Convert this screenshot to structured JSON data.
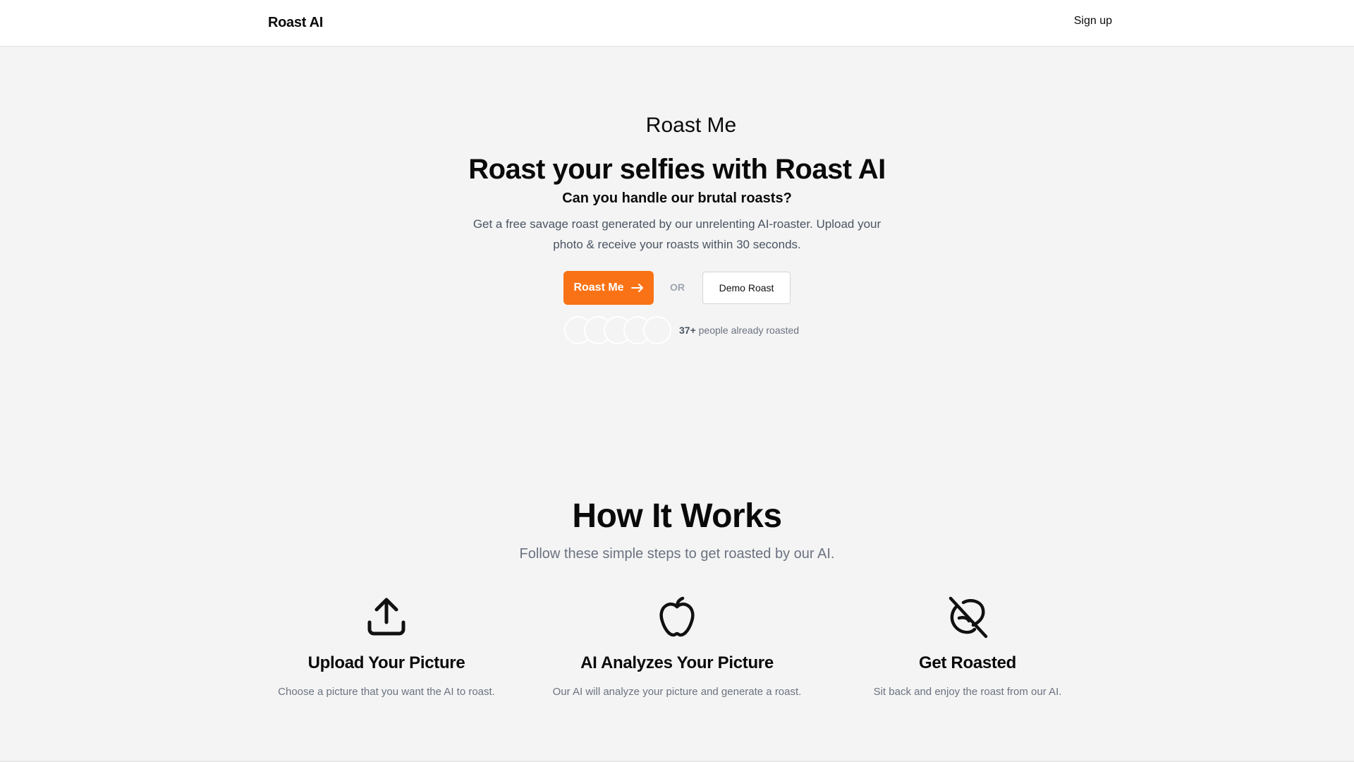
{
  "header": {
    "brand": "Roast AI",
    "signup_label": "Sign up"
  },
  "hero": {
    "eyebrow": "Roast Me",
    "headline": "Roast your selfies with Roast AI",
    "subhead": "Can you handle our brutal roasts?",
    "description": "Get a free savage roast generated by our unrelenting AI-roaster. Upload your photo & receive your roasts within 30 seconds.",
    "primary_cta": "Roast Me",
    "or_label": "OR",
    "secondary_cta": "Demo Roast",
    "social_count": "37+",
    "social_text": " people already roasted"
  },
  "how": {
    "title": "How It Works",
    "subtitle": "Follow these simple steps to get roasted by our AI.",
    "steps": [
      {
        "icon": "upload-icon",
        "title": "Upload Your Picture",
        "description": "Choose a picture that you want the AI to roast."
      },
      {
        "icon": "apple-icon",
        "title": "AI Analyzes Your Picture",
        "description": "Our AI will analyze your picture and generate a roast."
      },
      {
        "icon": "bean-off-icon",
        "title": "Get Roasted",
        "description": "Sit back and enjoy the roast from our AI."
      }
    ]
  },
  "colors": {
    "accent": "#f97316",
    "background": "#f4f4f4",
    "muted_text": "#6b7280"
  }
}
